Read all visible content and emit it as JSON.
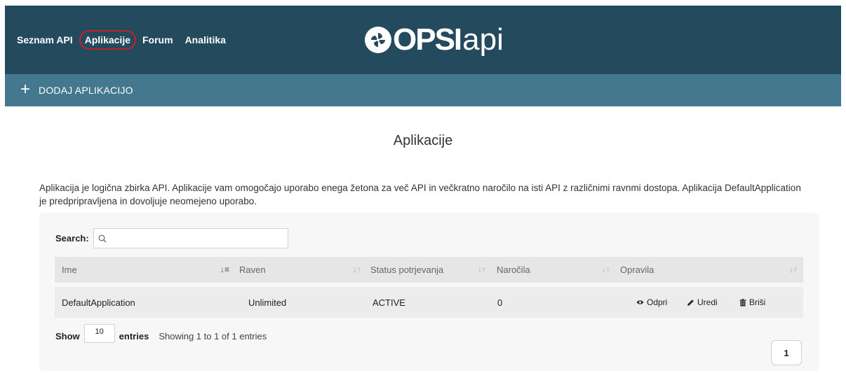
{
  "nav": {
    "items": [
      {
        "label": "Seznam API"
      },
      {
        "label": "Aplikacije"
      },
      {
        "label": "Forum"
      },
      {
        "label": "Analitika"
      }
    ]
  },
  "logo": {
    "bold": "OPSI",
    "light": "api"
  },
  "subbar": {
    "add_label": "DODAJ APLIKACIJO"
  },
  "page": {
    "title": "Aplikacije",
    "description": "Aplikacija je logična zbirka API. Aplikacije vam omogočajo uporabo enega žetona za več API in večkratno naročilo na isti API z različnimi ravnmi dostopa. Aplikacija DefaultApplication je predpripravljena in dovoljuje neomejeno uporabo."
  },
  "table": {
    "search_label": "Search:",
    "search_value": "",
    "columns": [
      "Ime",
      "Raven",
      "Status potrjevanja",
      "Naročila",
      "Opravila"
    ],
    "rows": [
      {
        "name": "DefaultApplication",
        "tier": "Unlimited",
        "status": "ACTIVE",
        "subscriptions": "0",
        "actions": {
          "open": "Odpri",
          "edit": "Uredi",
          "delete": "Briši"
        }
      }
    ],
    "show_label": "Show",
    "page_length": "10",
    "entries_label": "entries",
    "info": "Showing 1 to 1 of 1 entries",
    "current_page": "1"
  },
  "colors": {
    "header": "#234a5d",
    "subbar": "#43788f",
    "active_outline": "#c0232f"
  }
}
